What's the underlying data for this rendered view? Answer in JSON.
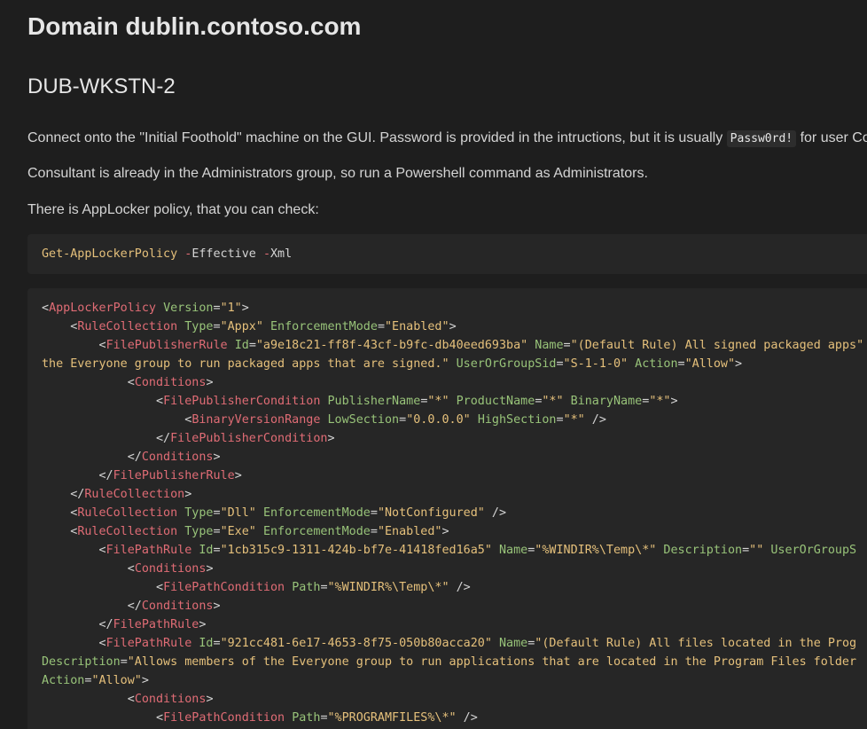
{
  "heading1": "Domain dublin.contoso.com",
  "heading2": "DUB-WKSTN-2",
  "para1": {
    "before": "Connect onto the \"Initial Foothold\" machine on the GUI. Password is provided in the intructions, but it is usually ",
    "code": "Passw0rd!",
    "after": " for user Co"
  },
  "para2": "Consultant is already in the Administrators group, so run a Powershell command as Administrators.",
  "para3": "There is AppLocker policy, that you can check:",
  "command": {
    "cmdlet": "Get-AppLockerPolicy",
    "flag1": "-",
    "param1": "Effective",
    "flag2": "-",
    "param2": "Xml"
  },
  "xml_lines": [
    [
      [
        "w",
        "<"
      ],
      [
        "r",
        "AppLockerPolicy"
      ],
      [
        "w",
        " "
      ],
      [
        "g",
        "Version"
      ],
      [
        "w",
        "="
      ],
      [
        "y",
        "\"1\""
      ],
      [
        "w",
        ">"
      ]
    ],
    [
      [
        "w",
        "    <"
      ],
      [
        "r",
        "RuleCollection"
      ],
      [
        "w",
        " "
      ],
      [
        "g",
        "Type"
      ],
      [
        "w",
        "="
      ],
      [
        "y",
        "\"Appx\""
      ],
      [
        "w",
        " "
      ],
      [
        "g",
        "EnforcementMode"
      ],
      [
        "w",
        "="
      ],
      [
        "y",
        "\"Enabled\""
      ],
      [
        "w",
        ">"
      ]
    ],
    [
      [
        "w",
        "        <"
      ],
      [
        "r",
        "FilePublisherRule"
      ],
      [
        "w",
        " "
      ],
      [
        "g",
        "Id"
      ],
      [
        "w",
        "="
      ],
      [
        "y",
        "\"a9e18c21-ff8f-43cf-b9fc-db40eed693ba\""
      ],
      [
        "w",
        " "
      ],
      [
        "g",
        "Name"
      ],
      [
        "w",
        "="
      ],
      [
        "y",
        "\"(Default Rule) All signed packaged apps\""
      ]
    ],
    [
      [
        "y",
        "the Everyone group to run packaged apps that are signed.\""
      ],
      [
        "w",
        " "
      ],
      [
        "g",
        "UserOrGroupSid"
      ],
      [
        "w",
        "="
      ],
      [
        "y",
        "\"S-1-1-0\""
      ],
      [
        "w",
        " "
      ],
      [
        "g",
        "Action"
      ],
      [
        "w",
        "="
      ],
      [
        "y",
        "\"Allow\""
      ],
      [
        "w",
        ">"
      ]
    ],
    [
      [
        "w",
        "            <"
      ],
      [
        "r",
        "Conditions"
      ],
      [
        "w",
        ">"
      ]
    ],
    [
      [
        "w",
        "                <"
      ],
      [
        "r",
        "FilePublisherCondition"
      ],
      [
        "w",
        " "
      ],
      [
        "g",
        "PublisherName"
      ],
      [
        "w",
        "="
      ],
      [
        "y",
        "\"*\""
      ],
      [
        "w",
        " "
      ],
      [
        "g",
        "ProductName"
      ],
      [
        "w",
        "="
      ],
      [
        "y",
        "\"*\""
      ],
      [
        "w",
        " "
      ],
      [
        "g",
        "BinaryName"
      ],
      [
        "w",
        "="
      ],
      [
        "y",
        "\"*\""
      ],
      [
        "w",
        ">"
      ]
    ],
    [
      [
        "w",
        "                    <"
      ],
      [
        "r",
        "BinaryVersionRange"
      ],
      [
        "w",
        " "
      ],
      [
        "g",
        "LowSection"
      ],
      [
        "w",
        "="
      ],
      [
        "y",
        "\"0.0.0.0\""
      ],
      [
        "w",
        " "
      ],
      [
        "g",
        "HighSection"
      ],
      [
        "w",
        "="
      ],
      [
        "y",
        "\"*\""
      ],
      [
        "w",
        " />"
      ]
    ],
    [
      [
        "w",
        "                </"
      ],
      [
        "r",
        "FilePublisherCondition"
      ],
      [
        "w",
        ">"
      ]
    ],
    [
      [
        "w",
        "            </"
      ],
      [
        "r",
        "Conditions"
      ],
      [
        "w",
        ">"
      ]
    ],
    [
      [
        "w",
        "        </"
      ],
      [
        "r",
        "FilePublisherRule"
      ],
      [
        "w",
        ">"
      ]
    ],
    [
      [
        "w",
        "    </"
      ],
      [
        "r",
        "RuleCollection"
      ],
      [
        "w",
        ">"
      ]
    ],
    [
      [
        "w",
        "    <"
      ],
      [
        "r",
        "RuleCollection"
      ],
      [
        "w",
        " "
      ],
      [
        "g",
        "Type"
      ],
      [
        "w",
        "="
      ],
      [
        "y",
        "\"Dll\""
      ],
      [
        "w",
        " "
      ],
      [
        "g",
        "EnforcementMode"
      ],
      [
        "w",
        "="
      ],
      [
        "y",
        "\"NotConfigured\""
      ],
      [
        "w",
        " />"
      ]
    ],
    [
      [
        "w",
        "    <"
      ],
      [
        "r",
        "RuleCollection"
      ],
      [
        "w",
        " "
      ],
      [
        "g",
        "Type"
      ],
      [
        "w",
        "="
      ],
      [
        "y",
        "\"Exe\""
      ],
      [
        "w",
        " "
      ],
      [
        "g",
        "EnforcementMode"
      ],
      [
        "w",
        "="
      ],
      [
        "y",
        "\"Enabled\""
      ],
      [
        "w",
        ">"
      ]
    ],
    [
      [
        "w",
        "        <"
      ],
      [
        "r",
        "FilePathRule"
      ],
      [
        "w",
        " "
      ],
      [
        "g",
        "Id"
      ],
      [
        "w",
        "="
      ],
      [
        "y",
        "\"1cb315c9-1311-424b-bf7e-41418fed16a5\""
      ],
      [
        "w",
        " "
      ],
      [
        "g",
        "Name"
      ],
      [
        "w",
        "="
      ],
      [
        "y",
        "\"%WINDIR%\\Temp\\*\""
      ],
      [
        "w",
        " "
      ],
      [
        "g",
        "Description"
      ],
      [
        "w",
        "="
      ],
      [
        "y",
        "\"\""
      ],
      [
        "w",
        " "
      ],
      [
        "g",
        "UserOrGroupS"
      ]
    ],
    [
      [
        "w",
        "            <"
      ],
      [
        "r",
        "Conditions"
      ],
      [
        "w",
        ">"
      ]
    ],
    [
      [
        "w",
        "                <"
      ],
      [
        "r",
        "FilePathCondition"
      ],
      [
        "w",
        " "
      ],
      [
        "g",
        "Path"
      ],
      [
        "w",
        "="
      ],
      [
        "y",
        "\"%WINDIR%\\Temp\\*\""
      ],
      [
        "w",
        " />"
      ]
    ],
    [
      [
        "w",
        "            </"
      ],
      [
        "r",
        "Conditions"
      ],
      [
        "w",
        ">"
      ]
    ],
    [
      [
        "w",
        "        </"
      ],
      [
        "r",
        "FilePathRule"
      ],
      [
        "w",
        ">"
      ]
    ],
    [
      [
        "w",
        "        <"
      ],
      [
        "r",
        "FilePathRule"
      ],
      [
        "w",
        " "
      ],
      [
        "g",
        "Id"
      ],
      [
        "w",
        "="
      ],
      [
        "y",
        "\"921cc481-6e17-4653-8f75-050b80acca20\""
      ],
      [
        "w",
        " "
      ],
      [
        "g",
        "Name"
      ],
      [
        "w",
        "="
      ],
      [
        "y",
        "\"(Default Rule) All files located in the Prog"
      ]
    ],
    [
      [
        "g",
        "Description"
      ],
      [
        "w",
        "="
      ],
      [
        "y",
        "\"Allows members of the Everyone group to run applications that are located in the Program Files folder"
      ]
    ],
    [
      [
        "g",
        "Action"
      ],
      [
        "w",
        "="
      ],
      [
        "y",
        "\"Allow\""
      ],
      [
        "w",
        ">"
      ]
    ],
    [
      [
        "w",
        "            <"
      ],
      [
        "r",
        "Conditions"
      ],
      [
        "w",
        ">"
      ]
    ],
    [
      [
        "w",
        "                <"
      ],
      [
        "r",
        "FilePathCondition"
      ],
      [
        "w",
        " "
      ],
      [
        "g",
        "Path"
      ],
      [
        "w",
        "="
      ],
      [
        "y",
        "\"%PROGRAMFILES%\\*\""
      ],
      [
        "w",
        " />"
      ]
    ]
  ]
}
